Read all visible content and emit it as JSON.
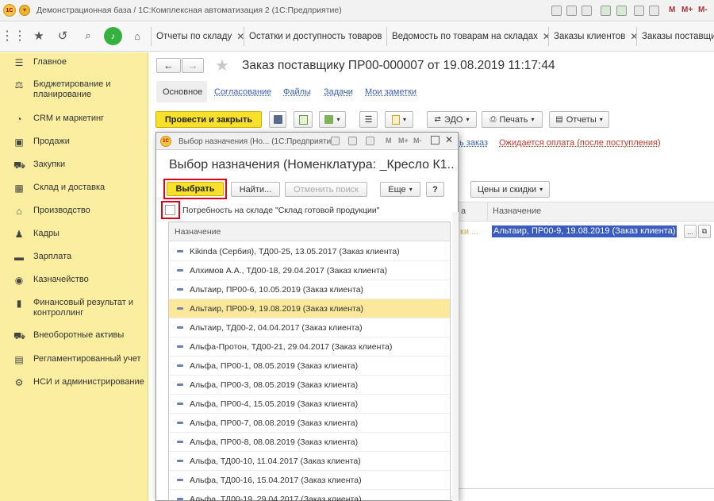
{
  "window": {
    "title": "Демонстрационная база / 1С:Комплексная автоматизация 2  (1С:Предприятие)",
    "right_tools": [
      "M",
      "M+",
      "M-"
    ]
  },
  "tabs": [
    {
      "label": "Отчеты по складу"
    },
    {
      "label": "Остатки и доступность товаров"
    },
    {
      "label": "Ведомость по товарам на складах"
    },
    {
      "label": "Заказы клиентов"
    },
    {
      "label": "Заказы поставщик"
    }
  ],
  "sidebar": {
    "items": [
      {
        "label": "Главное",
        "icon": "menu-icon"
      },
      {
        "label": "Бюджетирование и планирование",
        "icon": "budget-icon"
      },
      {
        "label": "CRM и маркетинг",
        "icon": "crm-icon"
      },
      {
        "label": "Продажи",
        "icon": "sales-bag-icon"
      },
      {
        "label": "Закупки",
        "icon": "cart-icon"
      },
      {
        "label": "Склад и доставка",
        "icon": "warehouse-icon"
      },
      {
        "label": "Производство",
        "icon": "factory-icon"
      },
      {
        "label": "Кадры",
        "icon": "person-icon"
      },
      {
        "label": "Зарплата",
        "icon": "salary-icon"
      },
      {
        "label": "Казначейство",
        "icon": "treasury-icon"
      },
      {
        "label": "Финансовый результат и контроллинг",
        "icon": "chart-icon"
      },
      {
        "label": "Внеоборотные активы",
        "icon": "car-icon"
      },
      {
        "label": "Регламентированный учет",
        "icon": "document-icon"
      },
      {
        "label": "НСИ и администрирование",
        "icon": "gear-icon"
      }
    ]
  },
  "form": {
    "title": "Заказ поставщику ПР00-000007 от 19.08.2019 11:17:44",
    "nav_tabs": [
      "Основное",
      "Согласование",
      "Файлы",
      "Задачи",
      "Мои заметки"
    ],
    "post_close_label": "Провести и закрыть",
    "edo_label": "ЭДО",
    "print_label": "Печать",
    "reports_label": "Отчеты",
    "link_order": "ь заказ",
    "status_text": "Ожидается оплата (после поступления)",
    "prices_label": "Цены и скидки",
    "table": {
      "col_a": "а",
      "col_purpose": "Назначение",
      "row_a": "ки ...",
      "row_purpose": "Альтаир, ПР00-9, 19.08.2019 (Заказ клиента)"
    }
  },
  "dialog": {
    "window_title": "Выбор назначения (Но... (1С:Предприятие)",
    "heading": "Выбор назначения (Номенклатура: _Кресло К1...",
    "select_label": "Выбрать",
    "find_label": "Найти...",
    "cancel_search_label": "Отменить поиск",
    "more_label": "Еще",
    "help_label": "?",
    "checkbox_label": "Потребность на складе \"Склад готовой продукции\"",
    "checkbox_checked": false,
    "column_header": "Назначение",
    "selected_index": 3,
    "rows": [
      "Kikinda (Сербия), ТД00-25, 13.05.2017 (Заказ клиента)",
      "Алхимов А.А., ТД00-18, 29.04.2017 (Заказ клиента)",
      "Альтаир, ПР00-6, 10.05.2019 (Заказ клиента)",
      "Альтаир, ПР00-9, 19.08.2019 (Заказ клиента)",
      "Альтаир, ТД00-2, 04.04.2017 (Заказ клиента)",
      "Альфа-Протон, ТД00-21, 29.04.2017 (Заказ клиента)",
      "Альфа, ПР00-1, 08.05.2019 (Заказ клиента)",
      "Альфа, ПР00-3, 08.05.2019 (Заказ клиента)",
      "Альфа, ПР00-4, 15.05.2019 (Заказ клиента)",
      "Альфа, ПР00-7, 08.08.2019 (Заказ клиента)",
      "Альфа, ПР00-8, 08.08.2019 (Заказ клиента)",
      "Альфа, ТД00-10, 11.04.2017 (Заказ клиента)",
      "Альфа, ТД00-16, 15.04.2017 (Заказ клиента)",
      "Альфа, ТД00-19, 29.04.2017 (Заказ клиента)"
    ]
  },
  "colors": {
    "sidebar_bg": "#fbeea0",
    "selected_row": "#fbe89a",
    "highlight_border": "#e0001a",
    "primary_button": "#f9e02a",
    "link": "#3b60b0",
    "status_red": "#c0392b"
  }
}
